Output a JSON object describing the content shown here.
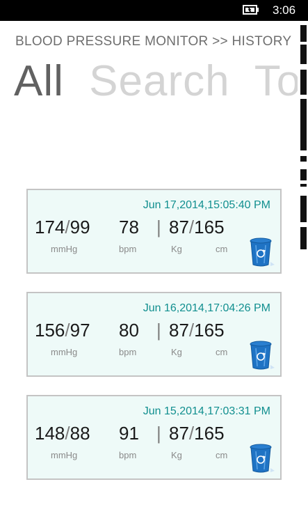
{
  "status_bar": {
    "time": "3:06"
  },
  "header": {
    "title": "BLOOD PRESSURE MONITOR >> HISTORY"
  },
  "pivot": {
    "tabs": [
      "All",
      "Search",
      "Tod"
    ]
  },
  "records": [
    {
      "date": "Jun 17,2014,15:05:40 PM",
      "systolic": "174",
      "diastolic": "99",
      "bpm": "78",
      "weight": "87",
      "height": "165"
    },
    {
      "date": "Jun 16,2014,17:04:26 PM",
      "systolic": "156",
      "diastolic": "97",
      "bpm": "80",
      "weight": "87",
      "height": "165"
    },
    {
      "date": "Jun 15,2014,17:03:31 PM",
      "systolic": "148",
      "diastolic": "88",
      "bpm": "91",
      "weight": "87",
      "height": "165"
    }
  ],
  "units": {
    "pressure": "mmHg",
    "pulse": "bpm",
    "weight": "Kg",
    "height": "cm"
  },
  "colors": {
    "date": "#118f8f",
    "card_bg": "#eefaf8",
    "card_border": "#c4c4c4",
    "trash": "#1f73c4"
  },
  "icons": {
    "battery": "battery-charging-icon",
    "delete": "recycle-bin-icon"
  }
}
